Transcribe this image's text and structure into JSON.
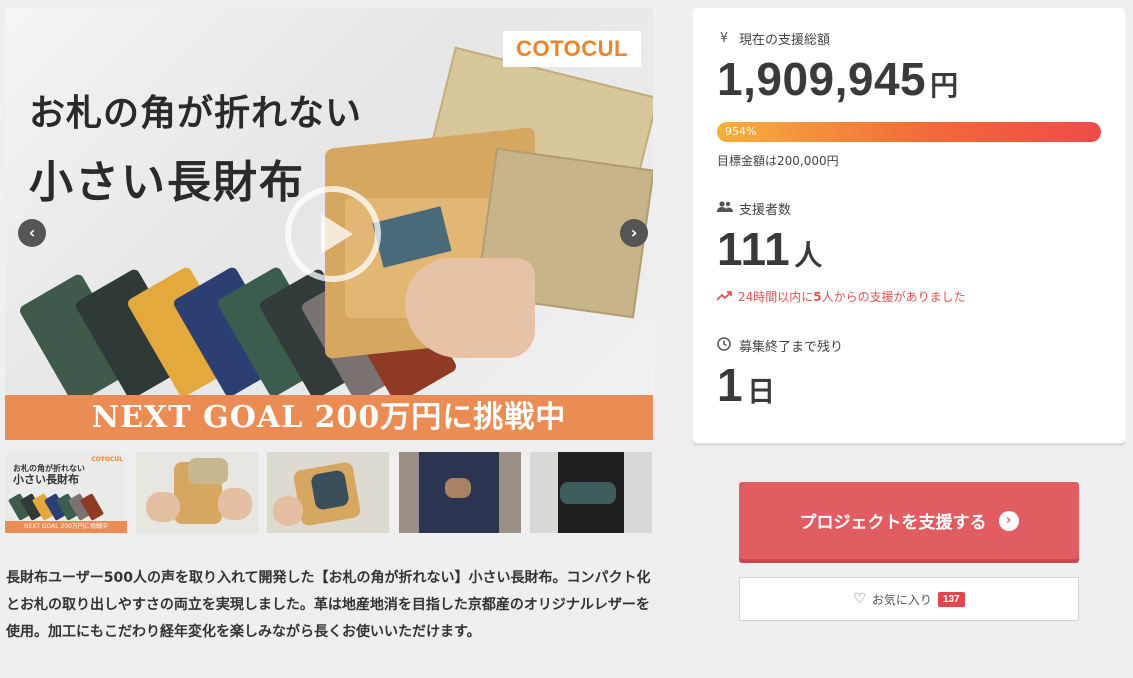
{
  "hero": {
    "logo": "COTOCUL",
    "title_line1": "お札の角が折れない",
    "title_line2": "小さい長財布",
    "banner": "NEXT GOAL 200万円に挑戦中",
    "prev_icon": "chevron-left-icon",
    "next_icon": "chevron-right-icon",
    "play_icon": "play-icon"
  },
  "thumbnails": {
    "first": {
      "title_line1": "お札の角が折れない",
      "title_line2": "小さい長財布",
      "logo": "COTOCUL",
      "banner": "NEXT GOAL 200万円に挑戦中"
    }
  },
  "description": "長財布ユーザー500人の声を取り入れて開発した【お札の角が折れない】小さい長財布。コンパクト化とお札の取り出しやすさの両立を実現しました。革は地産地消を目指した京都産のオリジナルレザーを使用。加工にもこだわり経年変化を楽しみながら長くお使いいただけます。",
  "stats": {
    "amount_label": "現在の支援総額",
    "amount_icon": "yen-icon",
    "amount_value": "1,909,945",
    "amount_unit": "円",
    "progress_text": "954%",
    "progress_fraction": 1.0,
    "goal_text": "目標金額は200,000円",
    "backers_label": "支援者数",
    "backers_icon": "users-icon",
    "backers_value": "111",
    "backers_unit": "人",
    "trend_icon": "trending-up-icon",
    "trend_prefix": "24時間以内に",
    "trend_count": "5",
    "trend_suffix": "人からの支援がありました",
    "remain_label": "募集終了まで残り",
    "remain_icon": "clock-icon",
    "remain_value": "1",
    "remain_unit": "日"
  },
  "actions": {
    "support_label": "プロジェクトを支援する",
    "support_icon": "arrow-circle-right-icon",
    "favorite_label": "お気に入り",
    "favorite_icon": "heart-icon",
    "favorite_count": "137"
  },
  "colors": {
    "accent": "#e25d62",
    "banner": "#eb8c55",
    "logo": "#f0822a",
    "progress_start": "#f4b03e",
    "progress_end": "#f04a4a",
    "trend": "#e0534f"
  }
}
